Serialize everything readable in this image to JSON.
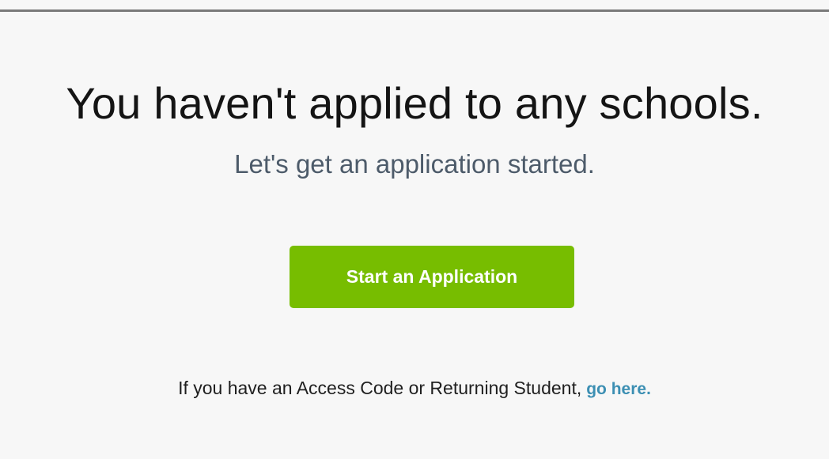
{
  "page": {
    "headline": "You haven't applied to any schools.",
    "subheadline": "Let's get an application started."
  },
  "actions": {
    "start_application_label": "Start an Application"
  },
  "access_code": {
    "prompt_text": "If you have an Access Code or Returning Student,",
    "link_label": "go here."
  },
  "colors": {
    "primary_button": "#77bd00",
    "link": "#3c8fb3",
    "subheadline_text": "#4d5b6a",
    "background": "#f7f7f7"
  }
}
